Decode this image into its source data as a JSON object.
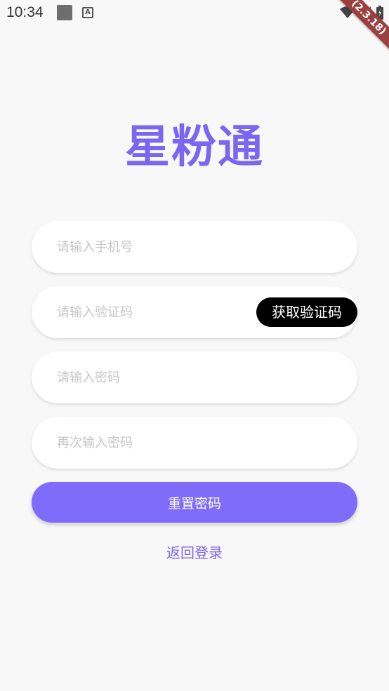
{
  "status_bar": {
    "time": "10:34",
    "notification_a_label": "A"
  },
  "debug_banner": {
    "label": "(2.3.18)"
  },
  "logo": {
    "text": "星粉通"
  },
  "form": {
    "phone_placeholder": "请输入手机号",
    "code_placeholder": "请输入验证码",
    "get_code_label": "获取验证码",
    "password_placeholder": "请输入密码",
    "confirm_password_placeholder": "再次输入密码",
    "submit_label": "重置密码",
    "back_label": "返回登录"
  },
  "colors": {
    "accent": "#7f6cfb",
    "logo": "#7b66f2",
    "background": "#f8f8f8"
  }
}
